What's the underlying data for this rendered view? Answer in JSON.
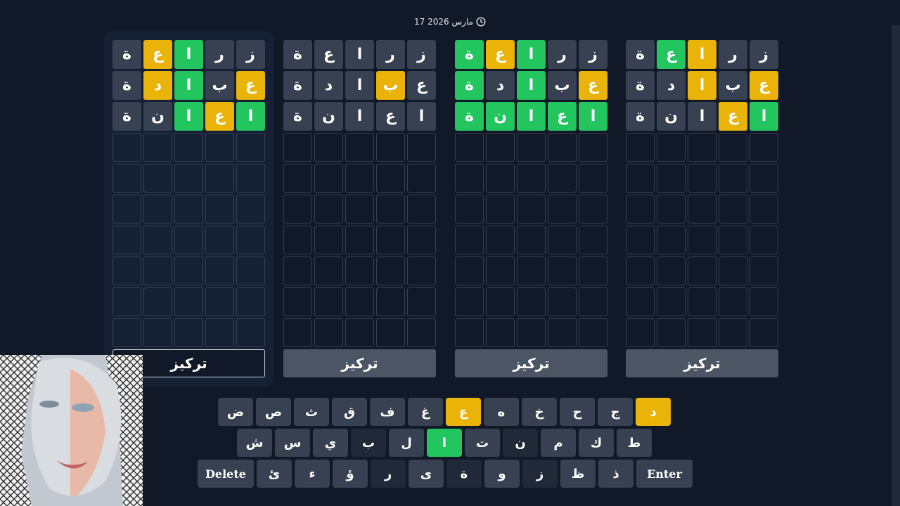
{
  "header": {
    "date": "17 مارس 2026",
    "clock_icon": "clock-icon"
  },
  "boards": [
    {
      "active": true,
      "focus_label": "تركيز",
      "rows": [
        [
          {
            "l": "ز",
            "s": "filled"
          },
          {
            "l": "ر",
            "s": "filled"
          },
          {
            "l": "ا",
            "s": "correct"
          },
          {
            "l": "ع",
            "s": "present"
          },
          {
            "l": "ة",
            "s": "filled"
          }
        ],
        [
          {
            "l": "ع",
            "s": "present"
          },
          {
            "l": "ب",
            "s": "filled"
          },
          {
            "l": "ا",
            "s": "correct"
          },
          {
            "l": "د",
            "s": "present"
          },
          {
            "l": "ة",
            "s": "filled"
          }
        ],
        [
          {
            "l": "ا",
            "s": "correct"
          },
          {
            "l": "ع",
            "s": "present"
          },
          {
            "l": "ا",
            "s": "correct"
          },
          {
            "l": "ن",
            "s": "filled"
          },
          {
            "l": "ة",
            "s": "filled"
          }
        ]
      ]
    },
    {
      "active": false,
      "focus_label": "تركيز",
      "rows": [
        [
          {
            "l": "ز",
            "s": "filled"
          },
          {
            "l": "ر",
            "s": "filled"
          },
          {
            "l": "ا",
            "s": "filled"
          },
          {
            "l": "ع",
            "s": "filled"
          },
          {
            "l": "ة",
            "s": "filled"
          }
        ],
        [
          {
            "l": "ع",
            "s": "filled"
          },
          {
            "l": "ب",
            "s": "present"
          },
          {
            "l": "ا",
            "s": "filled"
          },
          {
            "l": "د",
            "s": "filled"
          },
          {
            "l": "ة",
            "s": "filled"
          }
        ],
        [
          {
            "l": "ا",
            "s": "filled"
          },
          {
            "l": "ع",
            "s": "filled"
          },
          {
            "l": "ا",
            "s": "filled"
          },
          {
            "l": "ن",
            "s": "filled"
          },
          {
            "l": "ة",
            "s": "filled"
          }
        ]
      ]
    },
    {
      "active": false,
      "focus_label": "تركيز",
      "rows": [
        [
          {
            "l": "ز",
            "s": "filled"
          },
          {
            "l": "ر",
            "s": "filled"
          },
          {
            "l": "ا",
            "s": "correct"
          },
          {
            "l": "ع",
            "s": "present"
          },
          {
            "l": "ة",
            "s": "correct"
          }
        ],
        [
          {
            "l": "ع",
            "s": "present"
          },
          {
            "l": "ب",
            "s": "filled"
          },
          {
            "l": "ا",
            "s": "correct"
          },
          {
            "l": "د",
            "s": "filled"
          },
          {
            "l": "ة",
            "s": "correct"
          }
        ],
        [
          {
            "l": "ا",
            "s": "correct"
          },
          {
            "l": "ع",
            "s": "correct"
          },
          {
            "l": "ا",
            "s": "correct"
          },
          {
            "l": "ن",
            "s": "correct"
          },
          {
            "l": "ة",
            "s": "correct"
          }
        ]
      ]
    },
    {
      "active": false,
      "focus_label": "تركيز",
      "rows": [
        [
          {
            "l": "ز",
            "s": "filled"
          },
          {
            "l": "ر",
            "s": "filled"
          },
          {
            "l": "ا",
            "s": "present"
          },
          {
            "l": "ع",
            "s": "correct"
          },
          {
            "l": "ة",
            "s": "filled"
          }
        ],
        [
          {
            "l": "ع",
            "s": "present"
          },
          {
            "l": "ب",
            "s": "filled"
          },
          {
            "l": "ا",
            "s": "present"
          },
          {
            "l": "د",
            "s": "filled"
          },
          {
            "l": "ة",
            "s": "filled"
          }
        ],
        [
          {
            "l": "ا",
            "s": "correct"
          },
          {
            "l": "ع",
            "s": "present"
          },
          {
            "l": "ا",
            "s": "filled"
          },
          {
            "l": "ن",
            "s": "filled"
          },
          {
            "l": "ة",
            "s": "filled"
          }
        ]
      ]
    }
  ],
  "keyboard": {
    "row1": [
      {
        "l": "ض",
        "s": ""
      },
      {
        "l": "ص",
        "s": ""
      },
      {
        "l": "ث",
        "s": ""
      },
      {
        "l": "ق",
        "s": ""
      },
      {
        "l": "ف",
        "s": ""
      },
      {
        "l": "غ",
        "s": ""
      },
      {
        "l": "ع",
        "s": "present"
      },
      {
        "l": "ه",
        "s": ""
      },
      {
        "l": "خ",
        "s": ""
      },
      {
        "l": "ح",
        "s": ""
      },
      {
        "l": "ج",
        "s": ""
      },
      {
        "l": "د",
        "s": "present"
      }
    ],
    "row2": [
      {
        "l": "ش",
        "s": ""
      },
      {
        "l": "س",
        "s": ""
      },
      {
        "l": "ي",
        "s": ""
      },
      {
        "l": "ب",
        "s": "absent"
      },
      {
        "l": "ل",
        "s": ""
      },
      {
        "l": "ا",
        "s": "correct"
      },
      {
        "l": "ت",
        "s": ""
      },
      {
        "l": "ن",
        "s": "absent"
      },
      {
        "l": "م",
        "s": ""
      },
      {
        "l": "ك",
        "s": ""
      },
      {
        "l": "ط",
        "s": ""
      }
    ],
    "row3": [
      {
        "l": "Delete",
        "s": "",
        "wide": true
      },
      {
        "l": "ئ",
        "s": ""
      },
      {
        "l": "ء",
        "s": ""
      },
      {
        "l": "ؤ",
        "s": ""
      },
      {
        "l": "ر",
        "s": "absent"
      },
      {
        "l": "ى",
        "s": ""
      },
      {
        "l": "ة",
        "s": "absent"
      },
      {
        "l": "و",
        "s": ""
      },
      {
        "l": "ز",
        "s": "absent"
      },
      {
        "l": "ظ",
        "s": ""
      },
      {
        "l": "ذ",
        "s": ""
      },
      {
        "l": "Enter",
        "s": "",
        "wide": true
      }
    ]
  },
  "colors": {
    "correct": "#22c55e",
    "present": "#eab308",
    "absent": "#374151",
    "background": "#111827"
  }
}
